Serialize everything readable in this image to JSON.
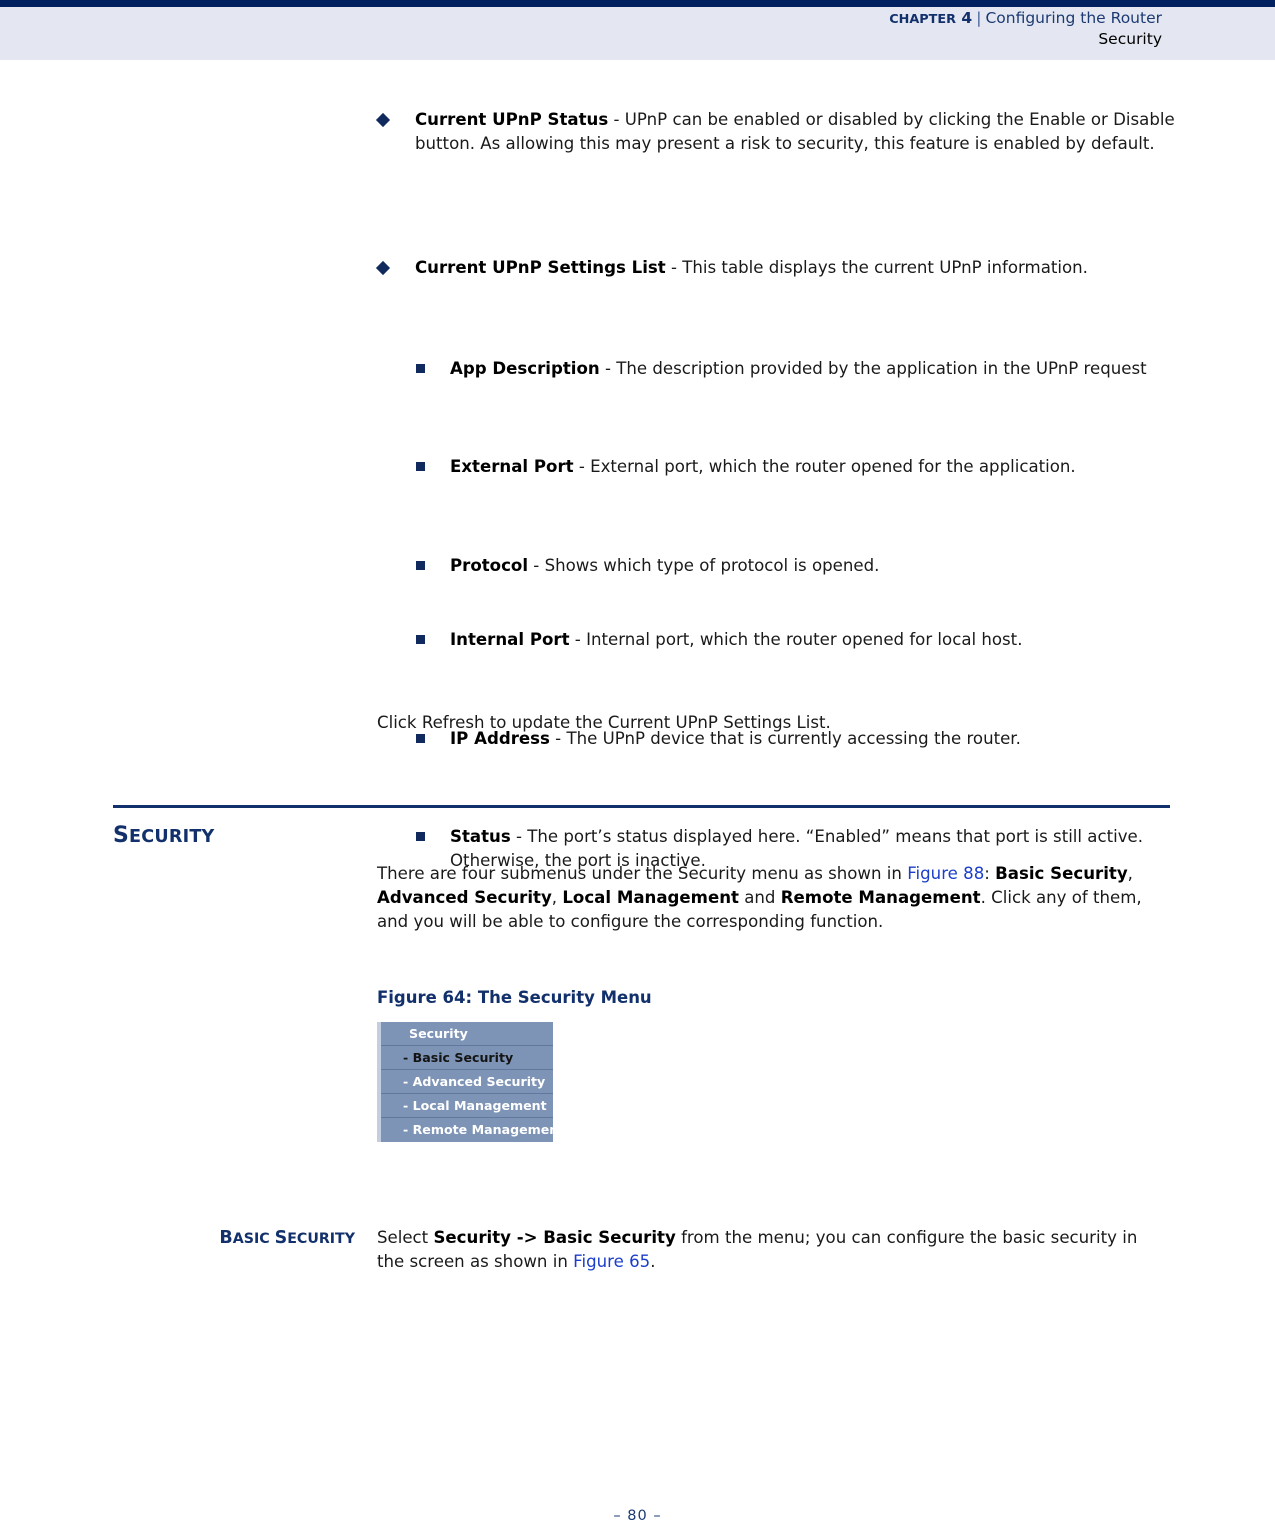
{
  "header": {
    "chapter_label": "CHAPTER 4",
    "chapter_prefix": "C",
    "chapter_rest": "HAPTER",
    "chapter_number": "4",
    "separator": "|",
    "title": "Configuring the Router",
    "subtitle": "Security"
  },
  "bullets": [
    {
      "term": "Current UPnP Status",
      "dash": " - ",
      "text": "UPnP can be enabled or disabled by clicking the Enable or Disable button. As allowing this may present a risk to security, this feature is enabled by default."
    },
    {
      "term": "Current UPnP Settings List",
      "dash": " - ",
      "text": "This table displays the current UPnP information."
    }
  ],
  "sub_bullets": [
    {
      "term": "App Description",
      "dash": " - ",
      "text": "The description provided by the application in the UPnP request"
    },
    {
      "term": "External Port",
      "dash": " - ",
      "text": "External port, which the router opened for the application."
    },
    {
      "term": "Protocol",
      "dash": " - ",
      "text": "Shows which type of protocol is opened."
    },
    {
      "term": "Internal Port",
      "dash": " - ",
      "text": "Internal port, which the router opened for local host."
    },
    {
      "term": "IP Address",
      "dash": " - ",
      "text": "The UPnP device that is currently accessing the router."
    },
    {
      "term": "Status",
      "dash": " - ",
      "text": "The port’s status displayed here. “Enabled” means that port is still active. Otherwise, the port is inactive."
    }
  ],
  "refresh_note": "Click Refresh to update the Current UPnP Settings List.",
  "section": {
    "heading_first": "S",
    "heading_rest": "ECURITY",
    "heading_full": "SECURITY",
    "intro_part1": "There are four submenus under the Security menu as shown in ",
    "intro_xref": "Figure 88",
    "intro_part2": ": ",
    "menu_1": "Basic Security",
    "menu_sep1": ", ",
    "menu_2": "Advanced Security",
    "menu_sep2": ", ",
    "menu_3": "Local Management",
    "menu_sep3": " and ",
    "menu_4": "Remote Management",
    "intro_part3": ". Click any of them, and you will be able to configure the corresponding function."
  },
  "figure": {
    "caption": "Figure 64:  The Security Menu",
    "menu_items": [
      {
        "label": "Security",
        "selected": false,
        "is_title": true
      },
      {
        "label": "- Basic Security",
        "selected": true,
        "is_title": false
      },
      {
        "label": "- Advanced Security",
        "selected": false,
        "is_title": false
      },
      {
        "label": "- Local Management",
        "selected": false,
        "is_title": false
      },
      {
        "label": "- Remote Management",
        "selected": false,
        "is_title": false
      }
    ]
  },
  "basic_security": {
    "side_heading_first": "B",
    "side_heading_mid": "ASIC ",
    "side_heading_s": "S",
    "side_heading_rest": "ECURITY",
    "side_heading_full": "BASIC SECURITY",
    "para_part1": "Select ",
    "para_bold": "Security -> Basic Security",
    "para_part2": " from the menu; you can configure the basic security in the screen as shown in ",
    "para_xref": "Figure 65",
    "para_part3": "."
  },
  "footer": {
    "page_number": "–  80  –"
  },
  "colors": {
    "navy_rule": "#002060",
    "header_band": "#e4e7f1",
    "heading_blue": "#12306b",
    "link_blue": "#1a3ecb",
    "menu_bg": "#7e94b6"
  }
}
